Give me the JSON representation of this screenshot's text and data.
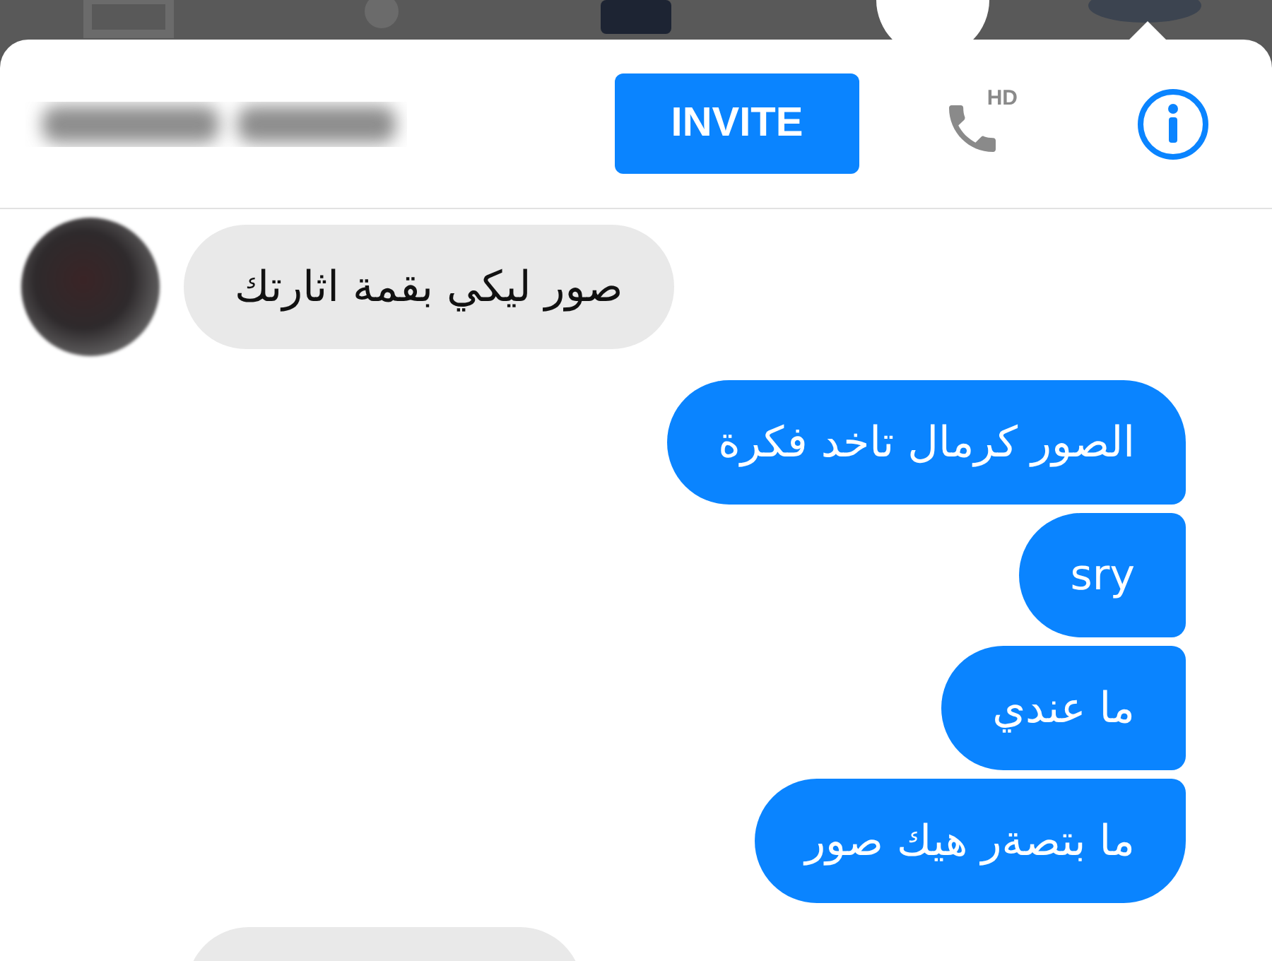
{
  "header": {
    "invite_button": "INVITE",
    "call_badge": "HD"
  },
  "messages": [
    {
      "kind": "incoming",
      "avatar": true,
      "text": "صور ليكي بقمة اثارتك"
    },
    {
      "kind": "outgoing",
      "text": "الصور كرمال تاخد فكرة"
    },
    {
      "kind": "outgoing",
      "text": "sry"
    },
    {
      "kind": "outgoing",
      "text": "ما عندي"
    },
    {
      "kind": "outgoing",
      "text": "ما بتصةر هيك صور"
    },
    {
      "kind": "incoming",
      "avatar": false
    }
  ]
}
